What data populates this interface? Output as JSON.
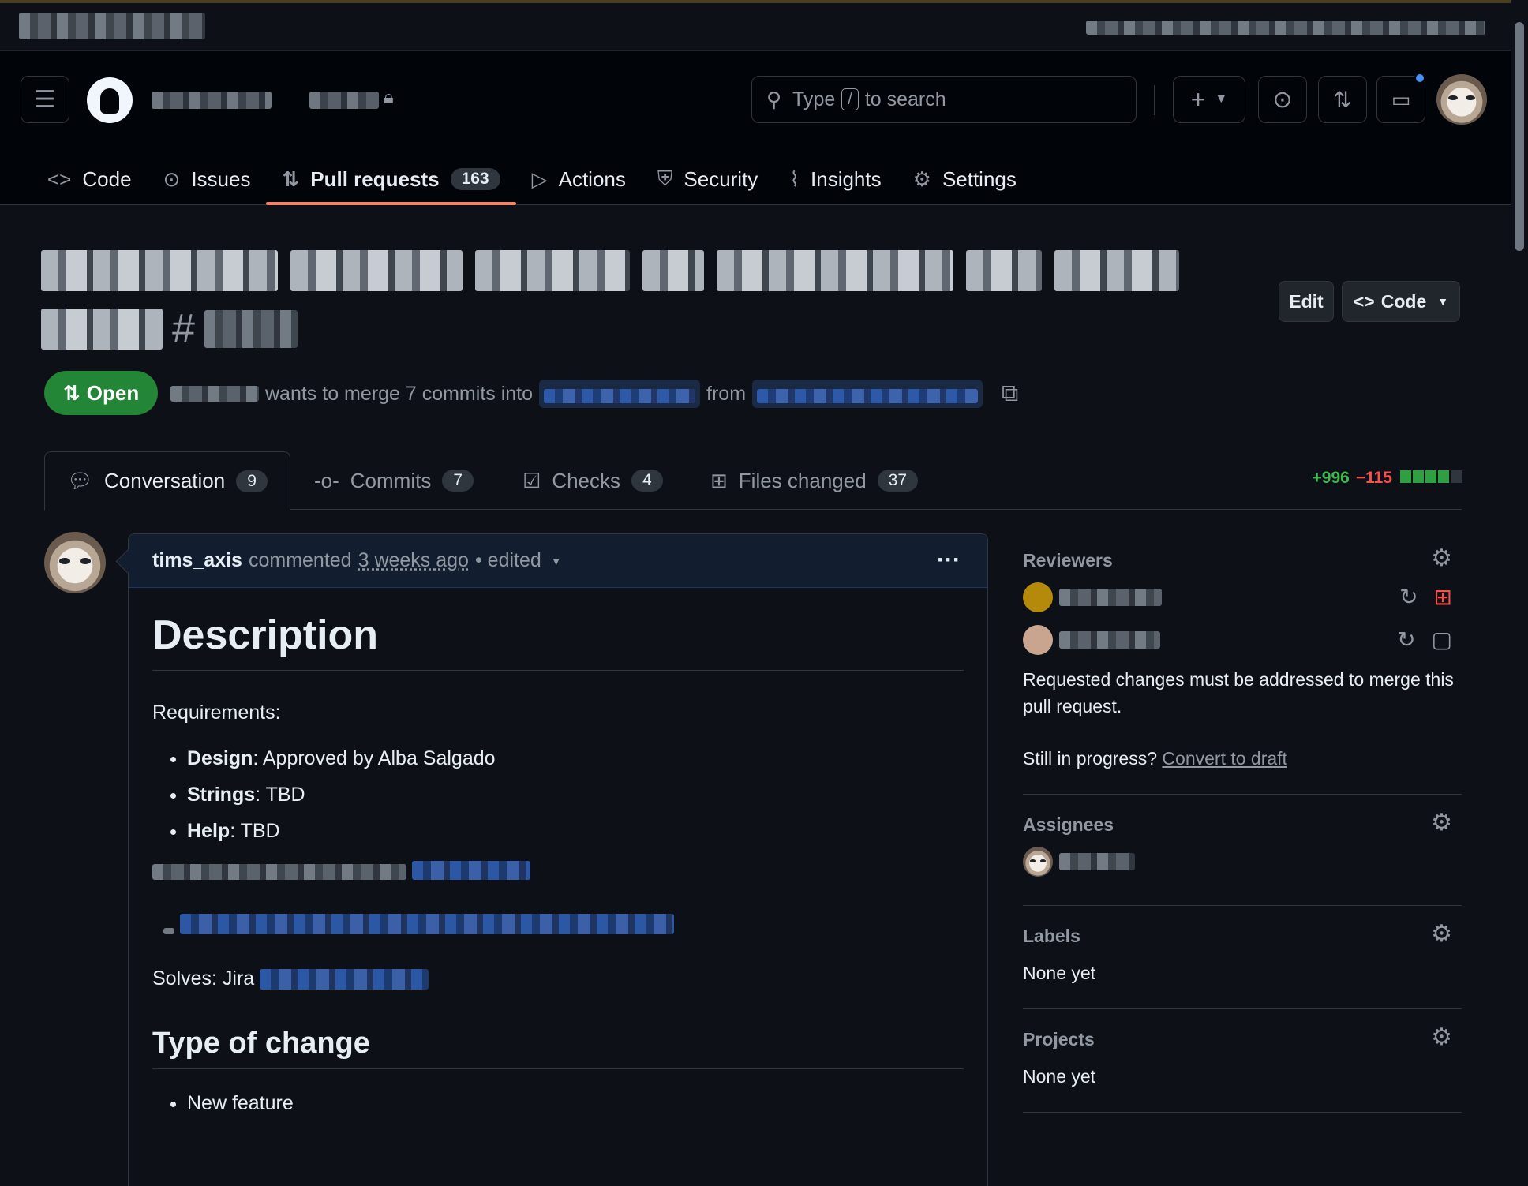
{
  "header": {
    "search_prefix": "Type",
    "search_key": "/",
    "search_suffix": "to search",
    "plus_label": "+"
  },
  "repo_tabs": [
    {
      "label": "Code",
      "icon": "<>"
    },
    {
      "label": "Issues",
      "icon": "⊙"
    },
    {
      "label": "Pull requests",
      "icon": "⇅",
      "count": "163"
    },
    {
      "label": "Actions",
      "icon": "▷"
    },
    {
      "label": "Security",
      "icon": "⛨"
    },
    {
      "label": "Insights",
      "icon": "⌇"
    },
    {
      "label": "Settings",
      "icon": "⚙"
    }
  ],
  "pr": {
    "number_prefix": "#",
    "state": "Open",
    "merge_text": "wants to merge 7 commits into",
    "from_text": "from",
    "edit_label": "Edit",
    "code_label": "Code"
  },
  "subtabs": {
    "conversation": {
      "label": "Conversation",
      "count": "9"
    },
    "commits": {
      "label": "Commits",
      "count": "7"
    },
    "checks": {
      "label": "Checks",
      "count": "4"
    },
    "files": {
      "label": "Files changed",
      "count": "37"
    },
    "additions": "+996",
    "deletions": "−115"
  },
  "comment": {
    "author": "tims_axis",
    "action": "commented",
    "time": "3 weeks ago",
    "edited": "• edited",
    "menu": "···",
    "h1": "Description",
    "requirements_label": "Requirements:",
    "req_items": [
      {
        "key": "Design",
        "val": ": Approved by Alba Salgado"
      },
      {
        "key": "Strings",
        "val": ": TBD"
      },
      {
        "key": "Help",
        "val": ": TBD"
      }
    ],
    "solves": "Solves: Jira",
    "h2": "Type of change",
    "type_items": [
      "New feature"
    ]
  },
  "sidebar": {
    "reviewers": {
      "title": "Reviewers",
      "note": "Requested changes must be addressed to merge this pull request.",
      "progress_q": "Still in progress?",
      "draft_link": "Convert to draft"
    },
    "assignees": {
      "title": "Assignees"
    },
    "labels": {
      "title": "Labels",
      "value": "None yet"
    },
    "projects": {
      "title": "Projects",
      "value": "None yet"
    }
  },
  "colors": {
    "accent": "#1f6feb",
    "open": "#238636",
    "add": "#3fb950",
    "del": "#f85149",
    "tab_underline": "#f78166"
  }
}
